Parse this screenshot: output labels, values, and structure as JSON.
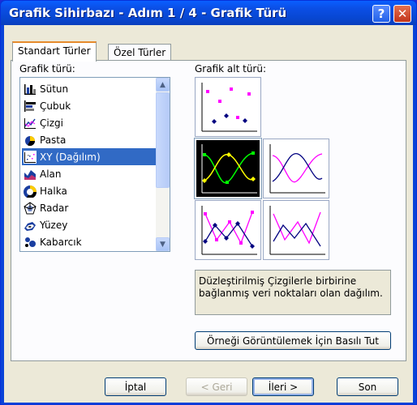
{
  "window": {
    "title": "Grafik Sihirbazı - Adım 1 / 4 - Grafik Türü",
    "help_label": "?",
    "close_label": "✕"
  },
  "tabs": [
    {
      "label": "Standart Türler",
      "active": true
    },
    {
      "label": "Özel Türler",
      "active": false
    }
  ],
  "chart_type_label": "Grafik türü:",
  "chart_types": [
    {
      "label": "Sütun",
      "icon": "column-chart-icon"
    },
    {
      "label": "Çubuk",
      "icon": "bar-chart-icon"
    },
    {
      "label": "Çizgi",
      "icon": "line-chart-icon"
    },
    {
      "label": "Pasta",
      "icon": "pie-chart-icon"
    },
    {
      "label": "XY (Dağılım)",
      "icon": "scatter-chart-icon",
      "selected": true
    },
    {
      "label": "Alan",
      "icon": "area-chart-icon"
    },
    {
      "label": "Halka",
      "icon": "doughnut-chart-icon"
    },
    {
      "label": "Radar",
      "icon": "radar-chart-icon"
    },
    {
      "label": "Yüzey",
      "icon": "surface-chart-icon"
    },
    {
      "label": "Kabarcık",
      "icon": "bubble-chart-icon"
    }
  ],
  "subtype_label": "Grafik alt türü:",
  "subtypes": [
    {
      "name": "scatter-markers-only",
      "selected": false
    },
    {
      "name": "scatter-smooth-lines-markers",
      "selected": true
    },
    {
      "name": "scatter-smooth-lines",
      "selected": false
    },
    {
      "name": "scatter-straight-lines-markers",
      "selected": false
    },
    {
      "name": "scatter-straight-lines",
      "selected": false
    }
  ],
  "description": "Düzleştirilmiş Çizgilerle birbirine bağlanmış veri noktaları olan dağılım.",
  "preview_button": "Örneği Görüntülemek İçin Basılı Tut",
  "footer": {
    "cancel": "İptal",
    "back": "< Geri",
    "next": "İleri >",
    "finish": "Son"
  },
  "colors": {
    "selection": "#316ac5",
    "magenta": "#ff00ff",
    "navy": "#000080",
    "accent_tab": "#e68b2c"
  }
}
